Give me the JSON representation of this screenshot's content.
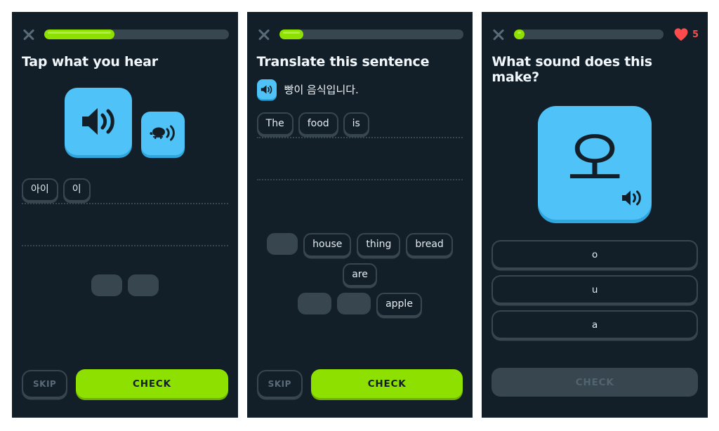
{
  "theme": {
    "background": "#ffffff",
    "panel_bg": "#131f28",
    "accent_green": "#8ee000",
    "accent_blue": "#4fc3f7",
    "heart_red": "#ff4b4b",
    "muted": "#37464f",
    "text": "#f1f7fb"
  },
  "panels": [
    {
      "id": "listening-tap-what-you-hear",
      "progress_percent": 38,
      "hearts_visible": false,
      "hearts_count": "",
      "prompt": "Tap what you hear",
      "audio": {
        "normal_label": "speaker-icon",
        "slow_label": "turtle-slow-speaker-icon"
      },
      "answer_tiles": [
        "아이",
        "이"
      ],
      "bank_blanks": 2,
      "skip_label": "SKIP",
      "check_label": "CHECK",
      "check_enabled": true
    },
    {
      "id": "translate-this-sentence",
      "progress_percent": 13,
      "hearts_visible": false,
      "hearts_count": "",
      "prompt": "Translate this sentence",
      "sentence": "빵이 음식입니다.",
      "sentence_speaker": "speaker-icon",
      "answer_tiles": [
        "The",
        "food",
        "is"
      ],
      "word_bank_row1": [
        "",
        "house",
        "thing",
        "bread",
        "are"
      ],
      "word_bank_row2": [
        "",
        "",
        "apple"
      ],
      "skip_label": "SKIP",
      "check_label": "CHECK",
      "check_enabled": true
    },
    {
      "id": "what-sound-does-this-make",
      "progress_percent": 7,
      "hearts_visible": true,
      "hearts_count": "5",
      "prompt": "What sound does this make?",
      "character": "오",
      "character_speaker": "speaker-icon",
      "choices": [
        "o",
        "u",
        "a"
      ],
      "check_label": "CHECK",
      "check_enabled": false
    }
  ]
}
